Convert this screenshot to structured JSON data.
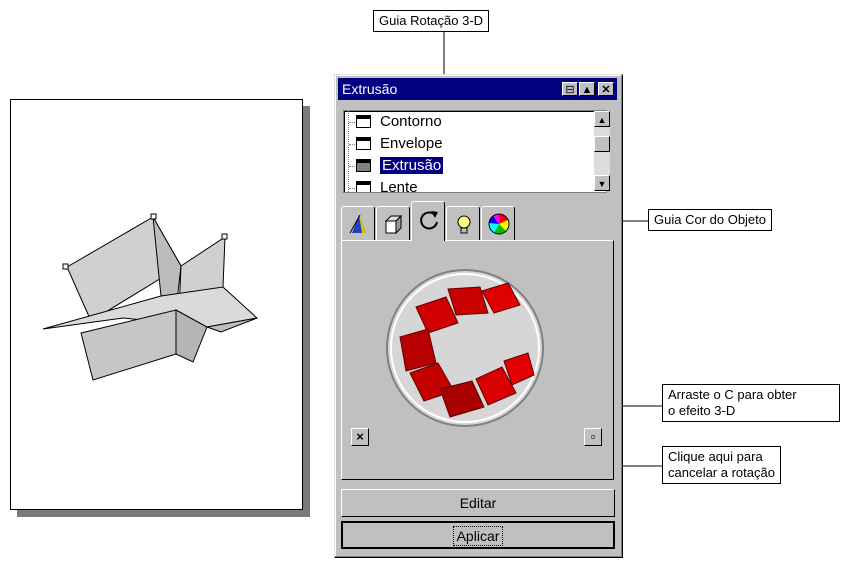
{
  "callouts": {
    "rotation_tab": "Guia Rotação 3-D",
    "color_tab": "Guia Cor do Objeto",
    "drag_c": [
      "Arraste o C para obter",
      "o efeito 3-D"
    ],
    "cancel": [
      "Clique aqui para",
      "cancelar a rotação"
    ]
  },
  "window": {
    "title": "Extrusão",
    "tree_items": [
      "Contorno",
      "Envelope",
      "Extrusão",
      "Lente"
    ],
    "selected_index": 2,
    "tabs": [
      {
        "icon": "vanishing-point-icon"
      },
      {
        "icon": "extrude-depth-icon"
      },
      {
        "icon": "rotation-icon",
        "active": true
      },
      {
        "icon": "lightbulb-icon"
      },
      {
        "icon": "color-wheel-icon"
      }
    ],
    "cancel_button": "×",
    "page_button": "▫",
    "edit_button": "Editar",
    "apply_button": "Aplicar"
  },
  "colors": {
    "titlebar": "#000080",
    "selection": "#000080",
    "extrusion_red": "#c80000",
    "panel": "#c0c0c0"
  }
}
